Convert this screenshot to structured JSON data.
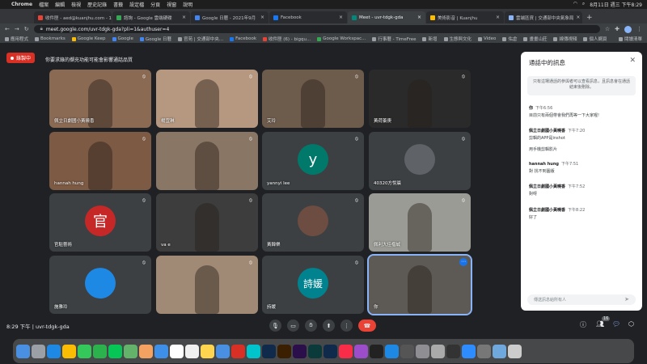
{
  "menubar": {
    "items": [
      "Chrome",
      "檔案",
      "編輯",
      "檢視",
      "歷史記錄",
      "書籤",
      "設定檔",
      "分頁",
      "視窗",
      "說明"
    ],
    "clock": "8月11日 週三 下午8:29"
  },
  "tabs": [
    {
      "label": "收件匣 - aed@kuanjhu.com - 1",
      "color": "#ea4335"
    },
    {
      "label": "諮詢 - Google 雲端硬碟",
      "color": "#34a853"
    },
    {
      "label": "Google 日曆 - 2021年9月",
      "color": "#4285f4"
    },
    {
      "label": "Facebook",
      "color": "#1877f2"
    },
    {
      "label": "Meet - uvr-tdgk-gda",
      "color": "#00897b",
      "active": true
    },
    {
      "label": "美術影音 | Kuanjhu",
      "color": "#fbbc04"
    },
    {
      "label": "雲端區資 | 交通部中央氣象局",
      "color": "#8ab4f8"
    }
  ],
  "address": "meet.google.com/uvr-tdgk-gda?pli=1&authuser=4",
  "bookmarks": [
    "應用程式",
    "Bookmarks",
    "Google Keep",
    "Google",
    "Google 日曆",
    "官苑 | 交通部中央...",
    "Facebook",
    "收件匣 (6) - bigqu...",
    "Google Workspac...",
    "行事曆 - TimeFree",
    "新增",
    "生態與文化",
    "Video",
    "佑倉",
    "畫畫山莊",
    "線傳視頻",
    "個人網頁",
    "閱讀清單"
  ],
  "meeting": {
    "recording_label": "錄製中",
    "recording_note": "你要求錄的擷充功能可能會影響通話品質",
    "code": "8:29 下午 | uvr-tdgk-gda",
    "participant_badge": "16"
  },
  "tiles": [
    {
      "name": "佩立日劇國小黃曉香",
      "bg": "#8b6a54"
    },
    {
      "name": "楊宜琳",
      "bg": "#b69880"
    },
    {
      "name": "艾玲",
      "bg": "#6d5b4c"
    },
    {
      "name": "黃荷蓁庚",
      "bg": "#2a2a2a"
    },
    {
      "name": "hannah hung",
      "bg": "#7d5a44"
    },
    {
      "name": "",
      "bg": "#8a7664"
    },
    {
      "name": "yannyi lee",
      "avatar": "y",
      "avatar_color": "#00796b"
    },
    {
      "name": "40320方悅晨",
      "avatar": "",
      "avatar_color": "#5f6368"
    },
    {
      "name": "官駐藝術",
      "avatar": "官",
      "avatar_color": "#c62828"
    },
    {
      "name": "va e",
      "bg": "#3d3d3d"
    },
    {
      "name": "黃韓樂",
      "avatar": "",
      "avatar_color": "#6d4c41"
    },
    {
      "name": "佩利大佳楷誠",
      "bg": "#9b9b95"
    },
    {
      "name": "施雅玲",
      "avatar": "",
      "avatar_color": "#1e88e5"
    },
    {
      "name": "",
      "bg": "#a08a76"
    },
    {
      "name": "詩媛",
      "avatar": "詩媛",
      "avatar_color": "#00838f"
    },
    {
      "name": "你",
      "bg": "#5d5a55"
    }
  ],
  "chat": {
    "title": "通話中的訊息",
    "note": "只有這場通話的參與者可以查看訊息，且訊息會在通話結束後刪除。",
    "messages": [
      {
        "sender": "你",
        "time": "下午6:56",
        "text": "目前只有兩個帶會我們再等一下大家喔!"
      },
      {
        "sender": "佩立日劇國小黃曉香",
        "time": "下午7:20",
        "text": "剪輯的APP是inshot"
      },
      {
        "sender": "",
        "time": "",
        "text": "用手機剪輯影片"
      },
      {
        "sender": "hannah hung",
        "time": "下午7:51",
        "text": "對 找不到圖版"
      },
      {
        "sender": "佩立日劇國小黃曉香",
        "time": "下午7:52",
        "text": "對呀"
      },
      {
        "sender": "佩立日劇國小黃曉香",
        "time": "下午8:22",
        "text": "好了"
      }
    ],
    "input_placeholder": "傳送訊息給所有人"
  }
}
